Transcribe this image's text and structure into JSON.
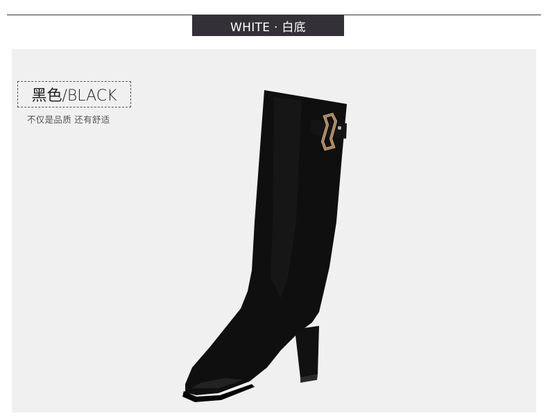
{
  "header": {
    "banner_text": "WHITE · 白底"
  },
  "product": {
    "color_label": "黑色/BLACK",
    "tagline": "不仅是品质 还有舒适",
    "image_icon": "black-knee-high-boot"
  },
  "colors": {
    "banner_bg": "#343037",
    "panel_bg": "#f0f0f0",
    "boot": "#0d0d0d",
    "buckle": "#c9a27a"
  }
}
